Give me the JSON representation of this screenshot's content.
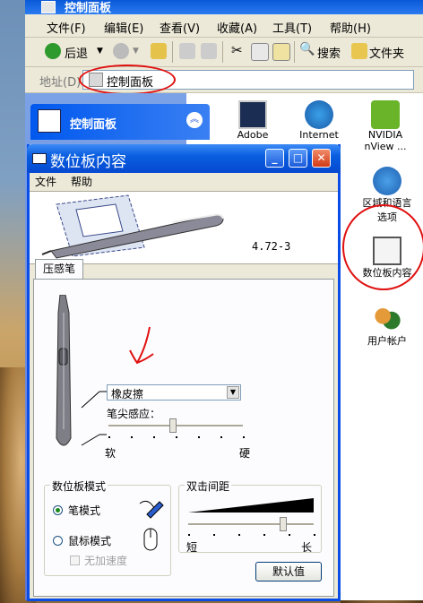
{
  "explorer": {
    "title": "控制面板",
    "menu": [
      "文件(F)",
      "编辑(E)",
      "查看(V)",
      "收藏(A)",
      "工具(T)",
      "帮助(H)"
    ],
    "toolbar": {
      "back": "后退",
      "search": "搜索",
      "folders": "文件夹"
    },
    "address": {
      "label": "地址(D)",
      "value": "控制面板"
    },
    "left_panel_title": "控制面板",
    "icons": [
      {
        "name": "adobe",
        "label": "Adobe"
      },
      {
        "name": "internet",
        "label": "Internet"
      },
      {
        "name": "nvidia",
        "label": "NVIDIA\nnView ..."
      },
      {
        "name": "region",
        "label": "区域和语言\n选项"
      },
      {
        "name": "tablet",
        "label": "数位板内容"
      },
      {
        "name": "users",
        "label": "用户帐户"
      }
    ]
  },
  "dialog": {
    "title": "数位板内容",
    "menu": [
      "文件",
      "帮助"
    ],
    "version": "4.72-3",
    "tab": "压感笔",
    "eraser_dropdown": "橡皮擦",
    "tip_feel_label": "笔尖感应：",
    "soft": "软",
    "firm": "硬",
    "slider_value": 0.48,
    "mode_group": {
      "title": "数位板模式",
      "pen": "笔模式",
      "mouse": "鼠标模式",
      "no_accel": "无加速度",
      "selected": "pen"
    },
    "double_click": {
      "title": "双击间距",
      "short": "短",
      "long": "长",
      "value": 0.76
    },
    "default_button": "默认值",
    "buttons": {
      "minimize": "_",
      "maximize": "□",
      "close": "✕"
    }
  }
}
